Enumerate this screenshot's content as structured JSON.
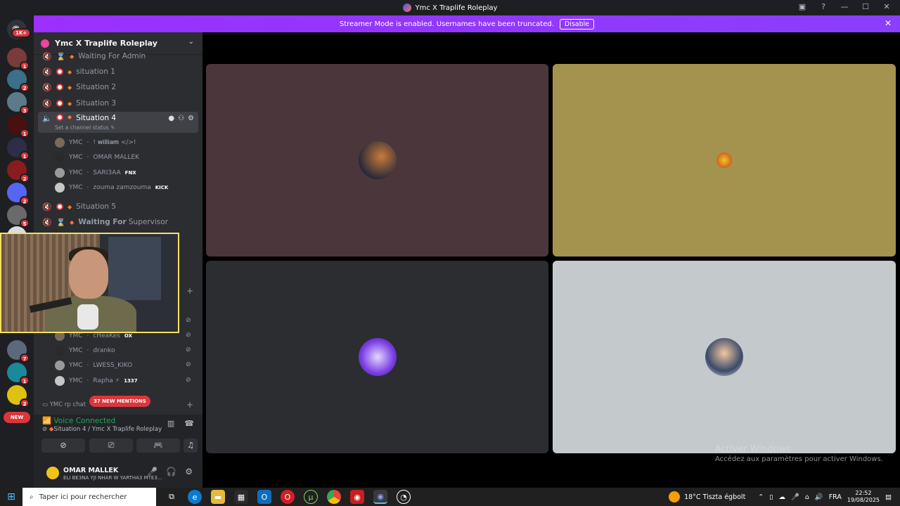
{
  "window": {
    "title": "Ymc X Traplife Roleplay"
  },
  "streamer_bar": {
    "message": "Streamer Mode is enabled. Usernames have been truncated.",
    "disable_label": "Disable",
    "close_icon": "close-icon"
  },
  "server_rail": {
    "dm_badge": "1K+",
    "new_label": "NEW",
    "servers": [
      {
        "badge": "1",
        "color": "#7a3b3b"
      },
      {
        "badge": "2",
        "color": "#3b6f8a"
      },
      {
        "badge": "3",
        "color": "#5d7a8a"
      },
      {
        "badge": "1",
        "color": "#4a1010"
      },
      {
        "badge": "1",
        "color": "#2d2d4a"
      },
      {
        "badge": "2",
        "color": "#8a1c1c"
      },
      {
        "badge": "2",
        "color": "#5865f2"
      },
      {
        "badge": "5",
        "color": "#6a6a6a"
      },
      {
        "badge": "",
        "color": "#dcdcdc"
      },
      {
        "badge": "7",
        "color": "#5a6a7a"
      },
      {
        "badge": "1",
        "color": "#1a8a9a"
      },
      {
        "badge": "2",
        "color": "#e0c010"
      }
    ]
  },
  "server": {
    "name": "Ymc X Traplife Roleplay"
  },
  "channels": {
    "waiting_admin": "Waiting For Admin",
    "situation1": "situation 1",
    "situation2": "Situation 2",
    "situation3": "Situation 3",
    "situation4": "Situation 4",
    "situation4_status": "Set a channel status",
    "situation5": "Situation 5",
    "waiting_supervisor_bold": "Waiting For",
    "waiting_supervisor_rest": "Supervisor",
    "rp_chat": "YMC rp chat"
  },
  "voice_users": [
    {
      "prefix": "YMC",
      "name": "! 𝐰𝐢𝐥𝐥𝐢𝐚𝐦 </>!",
      "tag": ""
    },
    {
      "prefix": "YMC",
      "name": "OMAR MALLEK",
      "tag": ""
    },
    {
      "prefix": "YMC",
      "name": "SARI3AA",
      "tag": "FNX"
    },
    {
      "prefix": "YMC",
      "name": "zouma zamzouma",
      "tag": "KICK"
    }
  ],
  "voice_users_lower": [
    {
      "prefix": "YMC",
      "name": "cHeaKes",
      "tag": "OX"
    },
    {
      "prefix": "YMC",
      "name": "dranko",
      "tag": ""
    },
    {
      "prefix": "YMC",
      "name": "LWESS_KIKO",
      "tag": ""
    },
    {
      "prefix": "YMC",
      "name": "Rapha ⚡",
      "tag": "1337"
    }
  ],
  "mentions": "37 NEW MENTIONS",
  "voice_connection": {
    "title": "Voice Connected",
    "subtitle": "Situation 4 / Ymc X Traplife Roleplay"
  },
  "user": {
    "name": "OMAR MALLEK",
    "status": "ELI BE3NA YJI NHAR W YARTHA3 MTE3..."
  },
  "watermark": {
    "title": "Activer Windows",
    "subtitle": "Accédez aux paramètres pour activer Windows."
  },
  "taskbar": {
    "search_placeholder": "Taper ici pour rechercher",
    "weather": "18°C  Tiszta égbolt",
    "lang": "FRA",
    "time": "22:52",
    "date": "19/08/2025"
  },
  "colors": {
    "accent": "#9b30ff",
    "tile1": "#4a363b",
    "tile2": "#a4924f",
    "tile3": "#2b2d31",
    "tile4": "#c4c9cc"
  }
}
